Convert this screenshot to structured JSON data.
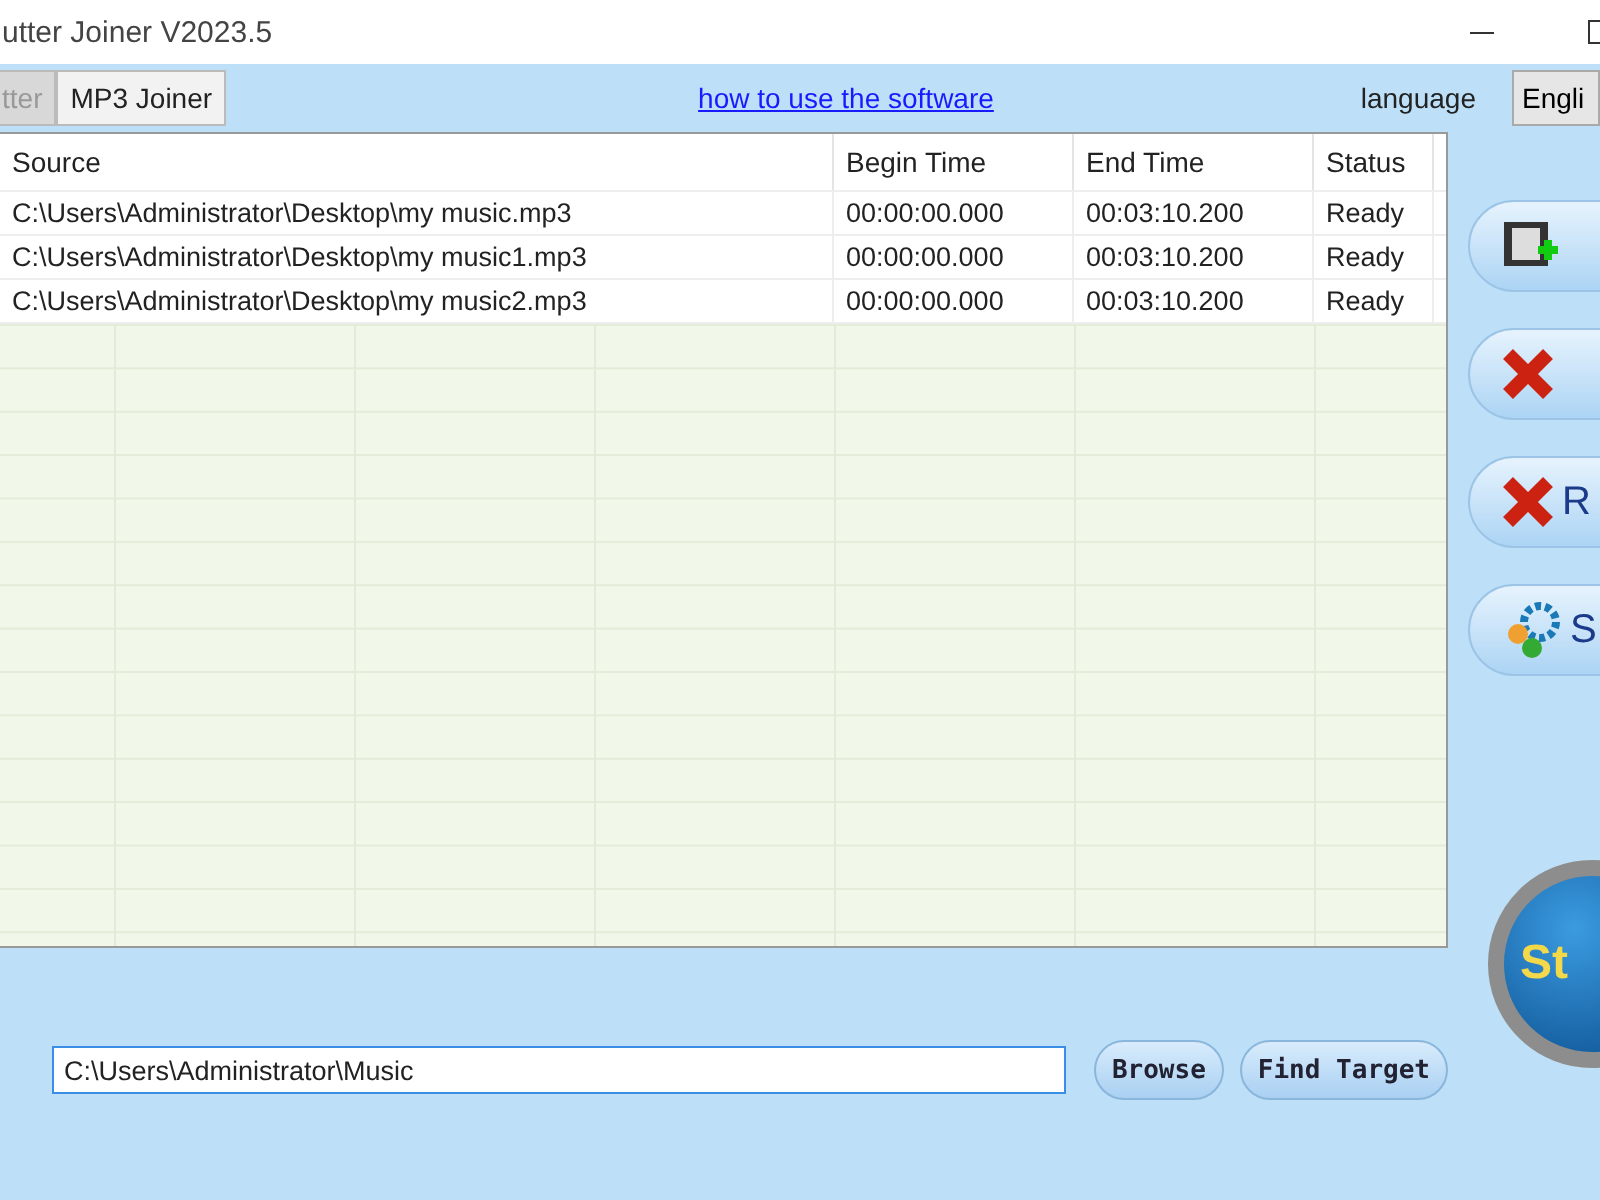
{
  "window": {
    "title": "utter Joiner V2023.5"
  },
  "tabs": [
    {
      "label": "tter",
      "selected": false
    },
    {
      "label": "MP3 Joiner",
      "selected": true
    }
  ],
  "help_link": "how to use the software",
  "language": {
    "label": "language",
    "value": "Engli"
  },
  "table": {
    "columns": [
      "Source",
      "Begin Time",
      "End Time",
      "Status"
    ],
    "rows": [
      [
        "C:\\Users\\Administrator\\Desktop\\my music.mp3",
        "00:00:00.000",
        "00:03:10.200",
        "Ready"
      ],
      [
        "C:\\Users\\Administrator\\Desktop\\my music1.mp3",
        "00:00:00.000",
        "00:03:10.200",
        "Ready"
      ],
      [
        "C:\\Users\\Administrator\\Desktop\\my music2.mp3",
        "00:00:00.000",
        "00:03:10.200",
        "Ready"
      ]
    ]
  },
  "side_buttons": [
    {
      "kind": "add"
    },
    {
      "kind": "delete"
    },
    {
      "kind": "remove",
      "label": "R"
    },
    {
      "kind": "settings",
      "label": "S"
    }
  ],
  "start_button": "St",
  "output": {
    "value": "C:\\Users\\Administrator\\Music",
    "buttons": [
      "Browse",
      "Find Target"
    ]
  }
}
